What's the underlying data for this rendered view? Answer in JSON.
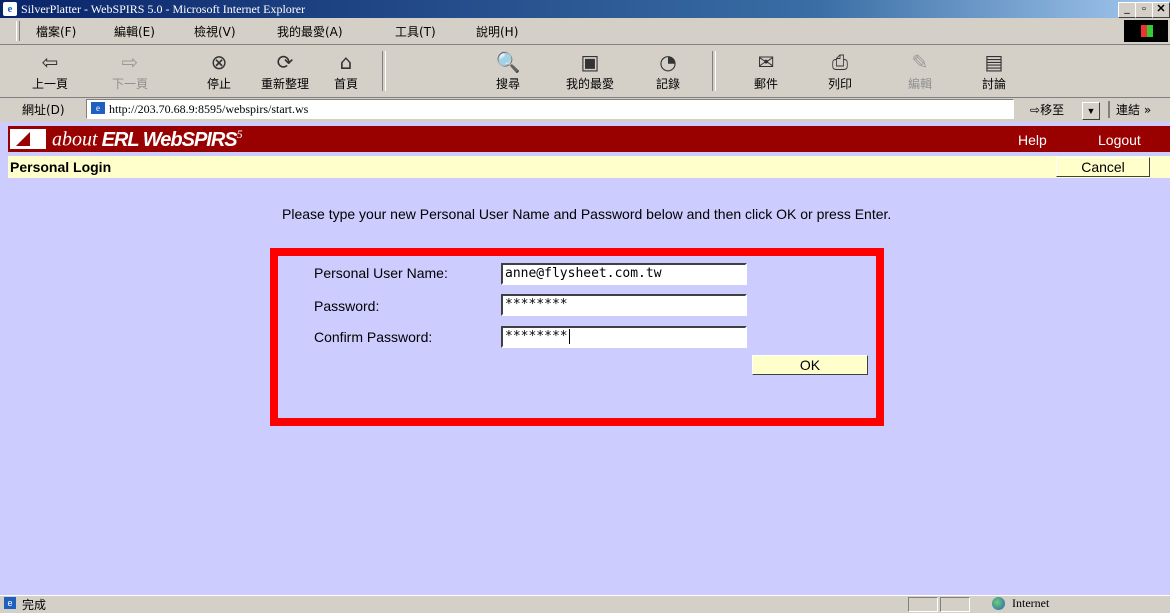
{
  "window": {
    "title": "SilverPlatter - WebSPIRS 5.0 - Microsoft Internet Explorer",
    "minimize": "_",
    "restore": "▫",
    "close": "✕"
  },
  "menu": {
    "items": [
      "檔案(F)",
      "編輯(E)",
      "檢視(V)",
      "我的最愛(A)",
      "工具(T)",
      "說明(H)"
    ]
  },
  "toolbar": {
    "back": "上一頁",
    "forward": "下一頁",
    "stop": "停止",
    "refresh": "重新整理",
    "home": "首頁",
    "search": "搜尋",
    "favorites": "我的最愛",
    "history": "記錄",
    "mail": "郵件",
    "print": "列印",
    "edit": "編輯",
    "discuss": "討論"
  },
  "address": {
    "label": "網址(D)",
    "url": "http://203.70.68.9:8595/webspirs/start.ws",
    "go": "移至",
    "links": "連結"
  },
  "app": {
    "brand_prefix": "about",
    "brand_name": "ERL WebSPIRS",
    "brand_version": "5",
    "help": "Help",
    "logout": "Logout",
    "page_title": "Personal Login",
    "cancel": "Cancel"
  },
  "form": {
    "instructions": "Please type your new Personal User Name and Password below and then click OK or press Enter.",
    "username_label": "Personal User Name:",
    "username_value": "anne@flysheet.com.tw",
    "password_label": "Password:",
    "password_value": "********",
    "confirm_label": "Confirm Password:",
    "confirm_value": "********",
    "ok": "OK"
  },
  "status": {
    "text": "完成",
    "zone": "Internet"
  },
  "colors": {
    "page_bg": "#ccccff",
    "app_bar": "#990000",
    "sub_bar": "#ffffcc",
    "highlight_box": "#ff0000"
  }
}
